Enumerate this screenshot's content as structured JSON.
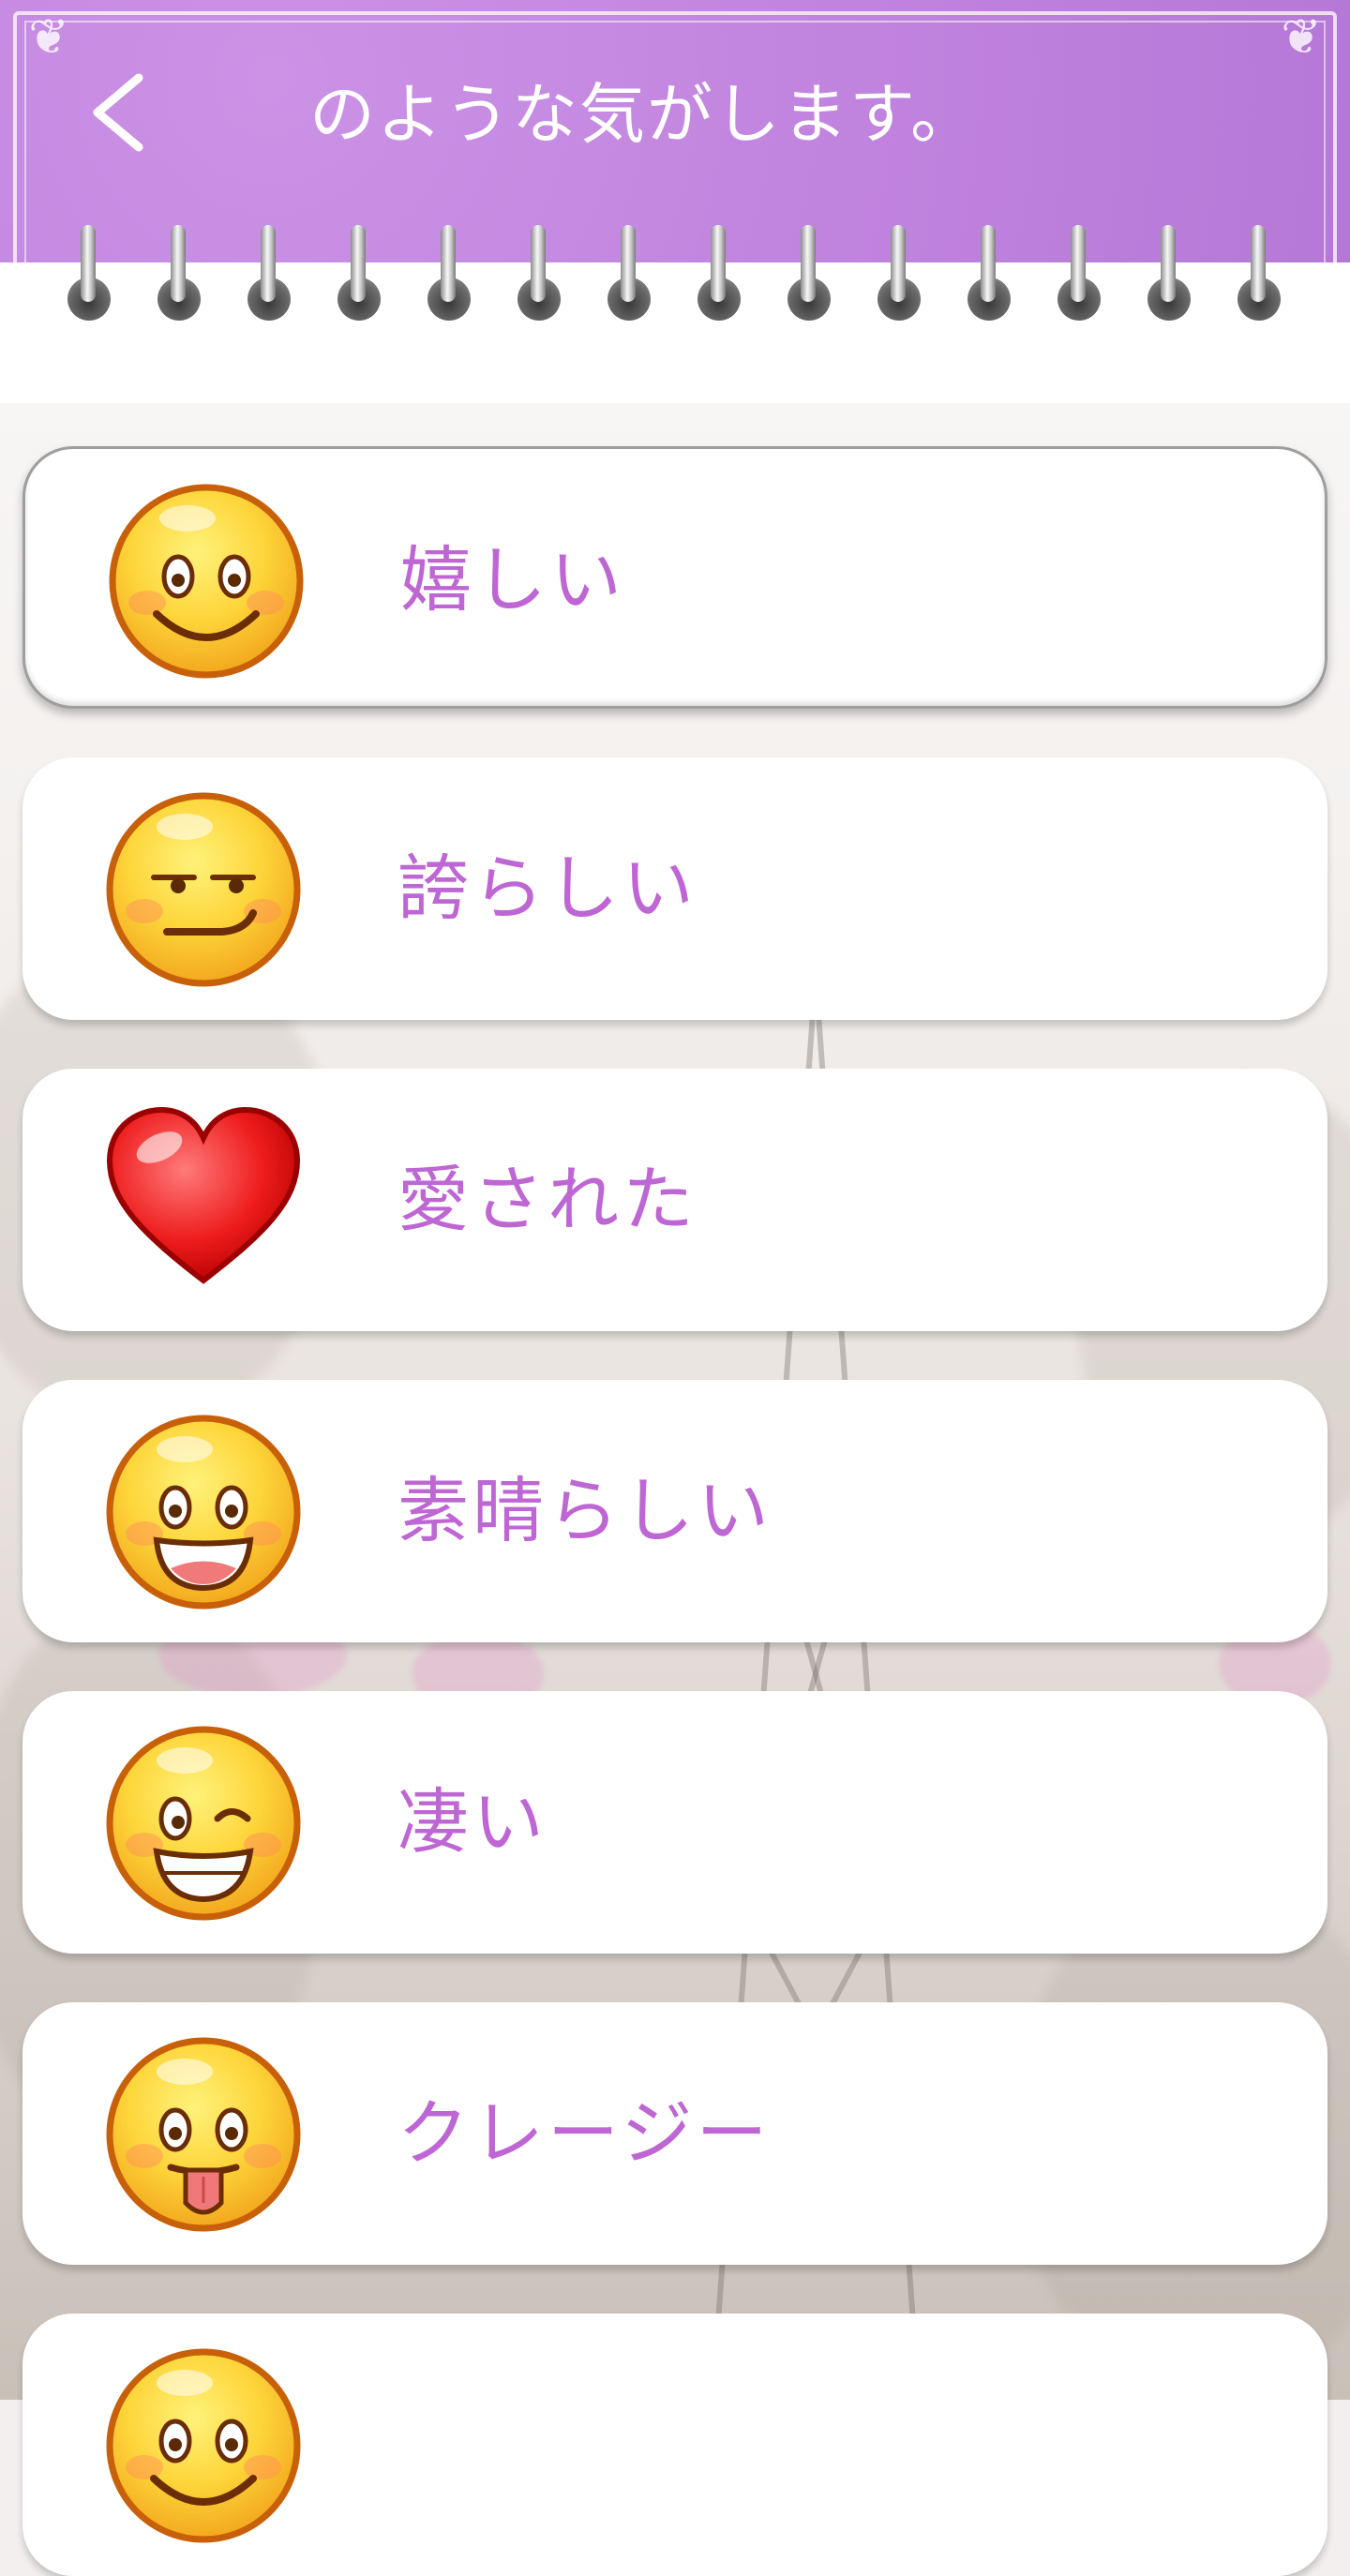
{
  "header": {
    "title": "のような気がします。",
    "back_icon": "chevron-left-icon",
    "color": "#c083de"
  },
  "accent_text_color": "#bd66d4",
  "feelings": [
    {
      "label": "嬉しい",
      "icon": "smile-icon",
      "selected": true
    },
    {
      "label": "誇らしい",
      "icon": "smirk-icon",
      "selected": false
    },
    {
      "label": "愛された",
      "icon": "heart-icon",
      "selected": false
    },
    {
      "label": "素晴らしい",
      "icon": "grin-icon",
      "selected": false
    },
    {
      "label": "凄い",
      "icon": "wink-icon",
      "selected": false
    },
    {
      "label": "クレージー",
      "icon": "tongue-out-icon",
      "selected": false
    },
    {
      "label": "",
      "icon": "smile-icon",
      "selected": false
    }
  ]
}
